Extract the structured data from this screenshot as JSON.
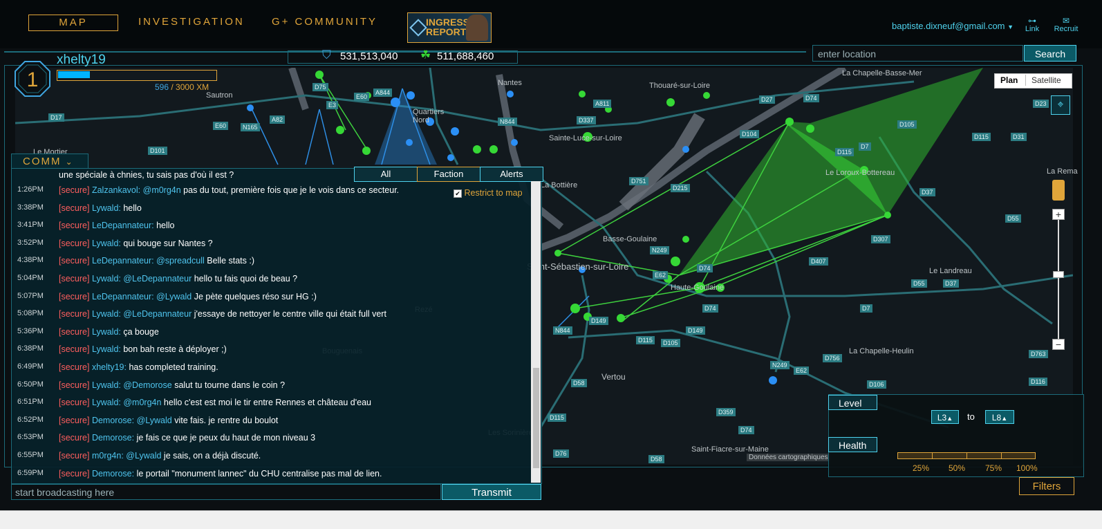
{
  "nav": {
    "map": "MAP",
    "investigation": "INVESTIGATION",
    "community": "G+ COMMUNITY",
    "report": "INGRESS REPORT"
  },
  "account": {
    "email": "baptiste.dixneuf@gmail.com",
    "link": "Link",
    "recruit": "Recruit"
  },
  "agent": {
    "level": "1",
    "name": "xhelty19",
    "xp_current": "596",
    "xp_total": "/ 3000 XM",
    "xp_fraction": 0.2
  },
  "scores": {
    "enlightened": "531,513,040",
    "resistance": "511,688,460"
  },
  "search": {
    "placeholder": "enter location",
    "button": "Search"
  },
  "map": {
    "types": [
      "Plan",
      "Satellite"
    ],
    "attribution": "Données cartographiques",
    "labels": [
      "Nantes",
      "Sautron",
      "Quartiers Nord",
      "Thouaré-sur-Loire",
      "La Chapelle-Basse-Mer",
      "Sainte-Luce-sur-Loire",
      "La Bottière",
      "Le Loroux-Bottereau",
      "Basse-Goulaine",
      "Saint-Sébastien-sur-Loire",
      "Haute-Goulaine",
      "Le Landreau",
      "La Chapelle-Heulin",
      "Vertou",
      "Rezé",
      "Bouguenais",
      "Les Sorinières",
      "Saint-Fiacre-sur-Maine",
      "Le Mortier",
      "La Rema"
    ],
    "roads": [
      "D75",
      "A844",
      "D17",
      "E60",
      "N165",
      "A82",
      "E3",
      "E60",
      "D101",
      "A811",
      "D337",
      "N844",
      "D751",
      "D215",
      "D104",
      "D27",
      "D74",
      "D105",
      "D115",
      "D7",
      "D23",
      "D115",
      "D31",
      "D37",
      "D55",
      "D307",
      "D407",
      "N249",
      "E62",
      "D74",
      "D149",
      "D115",
      "D105",
      "N844",
      "D58",
      "D149",
      "D37",
      "D55",
      "D7",
      "D756",
      "E62",
      "D106",
      "D763",
      "D116",
      "D359",
      "D74",
      "D76",
      "D58",
      "D115",
      "D74",
      "N249"
    ]
  },
  "comm": {
    "title": "COMM",
    "tabs": [
      "All",
      "Faction",
      "Alerts"
    ],
    "restrict": "Restrict to map",
    "partial": "une spéciale à chnies, tu sais pas d'où il est ?",
    "messages": [
      {
        "time": "1:26PM",
        "tag": "[secure]",
        "name": "Zalzankavol:",
        "mention": "@m0rg4n",
        "text": " pas du tout, première fois que je le vois dans ce secteur."
      },
      {
        "time": "3:38PM",
        "tag": "[secure]",
        "name": "Lywald:",
        "mention": "",
        "text": " hello"
      },
      {
        "time": "3:41PM",
        "tag": "[secure]",
        "name": "LeDepannateur:",
        "mention": "",
        "text": " hello"
      },
      {
        "time": "3:52PM",
        "tag": "[secure]",
        "name": "Lywald:",
        "mention": "",
        "text": " qui bouge sur Nantes ?"
      },
      {
        "time": "4:38PM",
        "tag": "[secure]",
        "name": "LeDepannateur:",
        "mention": "@spreadcull",
        "text": " Belle stats :)"
      },
      {
        "time": "5:04PM",
        "tag": "[secure]",
        "name": "Lywald:",
        "mention": "@LeDepannateur",
        "text": " hello tu fais quoi de beau ?"
      },
      {
        "time": "5:07PM",
        "tag": "[secure]",
        "name": "LeDepannateur:",
        "mention": "@Lywald",
        "text": " Je pète quelques réso sur HG :)"
      },
      {
        "time": "5:08PM",
        "tag": "[secure]",
        "name": "Lywald:",
        "mention": "@LeDepannateur",
        "text": " j'essaye de nettoyer le centre ville qui était full vert"
      },
      {
        "time": "5:36PM",
        "tag": "[secure]",
        "name": "Lywald:",
        "mention": "",
        "text": " ça bouge"
      },
      {
        "time": "6:38PM",
        "tag": "[secure]",
        "name": "Lywald:",
        "mention": "",
        "text": " bon bah reste à déployer ;)"
      },
      {
        "time": "6:49PM",
        "tag": "[secure]",
        "name": "xhelty19:",
        "mention": "",
        "text": " has completed training."
      },
      {
        "time": "6:50PM",
        "tag": "[secure]",
        "name": "Lywald:",
        "mention": "@Demorose",
        "text": " salut tu tourne dans le coin ?"
      },
      {
        "time": "6:51PM",
        "tag": "[secure]",
        "name": "Lywald:",
        "mention": "@m0rg4n",
        "text": " hello c'est est moi le tir entre Rennes et château d'eau"
      },
      {
        "time": "6:52PM",
        "tag": "[secure]",
        "name": "Demorose:",
        "mention": "@Lywald",
        "text": " vite fais. je rentre du boulot"
      },
      {
        "time": "6:53PM",
        "tag": "[secure]",
        "name": "Demorose:",
        "mention": "",
        "text": " je fais ce que je peux du haut de mon niveau 3"
      },
      {
        "time": "6:55PM",
        "tag": "[secure]",
        "name": "m0rg4n:",
        "mention": "@Lywald",
        "text": " je sais, on a déjà discuté."
      },
      {
        "time": "6:59PM",
        "tag": "[secure]",
        "name": "Demorose:",
        "mention": "",
        "text": " le portail \"monument lannec\" du CHU centralise pas mal de lien."
      }
    ],
    "broadcast_placeholder": "start broadcasting here",
    "transmit": "Transmit"
  },
  "filters": {
    "level_label": "Level",
    "level_from": "L3",
    "level_to_word": "to",
    "level_to": "L8",
    "health_label": "Health",
    "health_marks": [
      "25%",
      "50%",
      "75%",
      "100%"
    ],
    "button": "Filters"
  },
  "colors": {
    "accent": "#e0a53a",
    "cyan": "#4fd3ee",
    "enlightened": "#2fd62f",
    "resistance": "#1e8fff",
    "secure": "#ff5e5e"
  }
}
